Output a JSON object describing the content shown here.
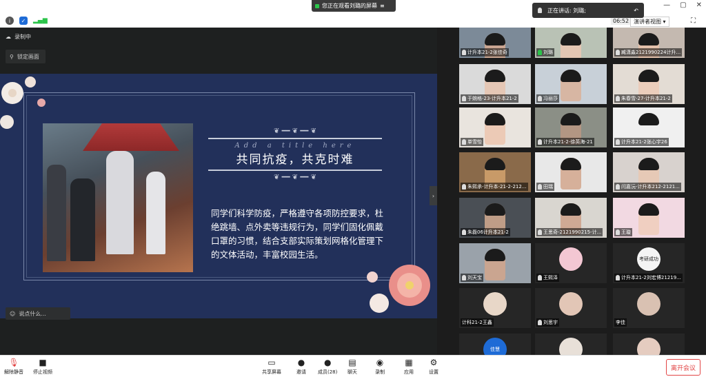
{
  "share_banner": {
    "text": "您正在观看刘璐的屏幕"
  },
  "speaker": {
    "label": "正在讲话: 刘璐;"
  },
  "window": {
    "minimize": "—",
    "maximize": "▢",
    "close": "✕"
  },
  "meeting": {
    "timer": "06:52",
    "view_mode": "演讲者视图"
  },
  "main_view": {
    "recording_label": "录制中",
    "lock_screen_label": "锁定画面",
    "chat_placeholder": "说点什么...",
    "collapse_glyph": "›"
  },
  "slide": {
    "subtitle_en": "Add a title here",
    "title_cn": "共同抗疫，共克时难",
    "body": "同学们科学防疫，严格遵守各项防控要求，杜绝跳墙、点外卖等违规行为，同学们固化佩戴口罩的习惯，结合支部实际策划网格化管理下的文体活动，丰富校园生活。"
  },
  "participants": [
    {
      "name": "计升本21-2张佳奇",
      "kind": "video",
      "bg": "#7c8a98",
      "face": "#caa692",
      "mic": "muted"
    },
    {
      "name": "刘璐",
      "kind": "video",
      "bg": "#b9c2b5",
      "face": "#e3c6b3",
      "mic": "active"
    },
    {
      "name": "臧潇淼2121990224计升...",
      "kind": "video",
      "bg": "#c4b9b0",
      "face": "#e4c1ab",
      "mic": "muted"
    },
    {
      "name": "于婉格-23-计升本21-2",
      "kind": "video",
      "bg": "#dadada",
      "face": "#e5c7b5",
      "mic": "muted"
    },
    {
      "name": "冯丽莎",
      "kind": "video",
      "bg": "#c8d0d8",
      "face": "#d7b6a3",
      "mic": "muted"
    },
    {
      "name": "朱春雪-27-计升本21-2",
      "kind": "video",
      "bg": "#e3dcd4",
      "face": "#ebcdbb",
      "mic": "muted"
    },
    {
      "name": "单雪怡",
      "kind": "video",
      "bg": "#e9e4de",
      "face": "#eccab6",
      "mic": "muted"
    },
    {
      "name": "计升本21-2-徐英海-21",
      "kind": "video",
      "bg": "#8b8f86",
      "face": "#b39683",
      "mic": "muted"
    },
    {
      "name": "计升本21-2张心宇26",
      "kind": "video",
      "bg": "#f0f0f0",
      "face": "#f0f0f0",
      "mic": "muted"
    },
    {
      "name": "朱熙承-计升本-21-2-212...",
      "kind": "video",
      "bg": "#8a6a4a",
      "face": "#c89a68",
      "mic": "muted"
    },
    {
      "name": "田瑞",
      "kind": "video",
      "bg": "#e8e8e8",
      "face": "#d6b09a",
      "mic": "muted"
    },
    {
      "name": "闫嘉沅-计升本212-2121...",
      "kind": "video",
      "bg": "#d8d2ce",
      "face": "#e6c9b6",
      "mic": "muted"
    },
    {
      "name": "朱磊06计升本21-2",
      "kind": "video",
      "bg": "#4a4f55",
      "face": "#bf9d87",
      "mic": "muted"
    },
    {
      "name": "王思奇-2121990215-计...",
      "kind": "video",
      "bg": "#d9d6d0",
      "face": "#cfa994",
      "mic": "muted"
    },
    {
      "name": "王璇",
      "kind": "video",
      "bg": "#f2d9e2",
      "face": "#f0cfc1",
      "mic": "muted"
    },
    {
      "name": "刘天宝",
      "kind": "video",
      "bg": "#9aa2aa",
      "face": "#caa590",
      "mic": "muted"
    },
    {
      "name": "王熙泽",
      "kind": "avatar",
      "bg": "#262626",
      "avatar": "#f3c7d3",
      "mic": "muted"
    },
    {
      "name": "计升本21-2刘宏博21219...",
      "kind": "avatar",
      "bg": "#262626",
      "avatar": "#f4f4f4",
      "avatar_text": "考研成功",
      "mic": "muted"
    },
    {
      "name": "计科21-2王鑫",
      "kind": "avatar",
      "bg": "#262626",
      "avatar": "#e8d7c8",
      "mic": "none"
    },
    {
      "name": "刘思宇",
      "kind": "avatar",
      "bg": "#262626",
      "avatar": "#e2c6b6",
      "mic": "muted"
    },
    {
      "name": "李佳",
      "kind": "avatar",
      "bg": "#262626",
      "avatar": "#d9c1b2",
      "mic": "none"
    },
    {
      "name": "",
      "kind": "avatar",
      "bg": "#262626",
      "avatar": "#1e6bd6",
      "avatar_text": "佳慧",
      "mic": "none"
    },
    {
      "name": "",
      "kind": "avatar",
      "bg": "#262626",
      "avatar": "#e8e0d8",
      "mic": "none"
    },
    {
      "name": "",
      "kind": "avatar",
      "bg": "#262626",
      "avatar": "#e5ccc0",
      "mic": "none"
    }
  ],
  "bottom_bar": {
    "mute": "解除静音",
    "stop_video": "停止视频",
    "share": "共享屏幕",
    "invite": "邀请",
    "members": "成员(28)",
    "chat": "聊天",
    "record": "录制",
    "apps": "应用",
    "settings": "设置",
    "leave": "离开会议"
  },
  "colors": {
    "accent_green": "#2bc44a",
    "leave_red": "#e24444",
    "slide_navy": "#22305a"
  }
}
